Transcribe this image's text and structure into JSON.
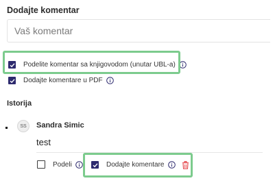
{
  "comment_section": {
    "title": "Dodajte komentar",
    "input_placeholder": "Vaš komentar",
    "input_value": ""
  },
  "options": {
    "share_with_accountant": {
      "label": "Podelite komentar sa knjigovodom (unutar UBL-a)",
      "checked": true
    },
    "add_to_pdf": {
      "label": "Dodajte komentare u PDF",
      "checked": true
    }
  },
  "history": {
    "title": "Istorija",
    "entries": [
      {
        "initials": "SS",
        "author": "Sandra Simic",
        "text": "test",
        "share_label": "Podeli",
        "share_checked": false,
        "add_comments_label": "Dodajte komentare",
        "add_comments_checked": true
      }
    ]
  },
  "colors": {
    "checkbox_fill": "#2d2a6e",
    "highlight_border": "#7ccb8d",
    "delete_icon": "#e5484d",
    "info_icon": "#2d2a6e"
  },
  "icons": {
    "info": "info-circle-icon",
    "delete": "trash-icon",
    "check": "checkmark-icon"
  }
}
